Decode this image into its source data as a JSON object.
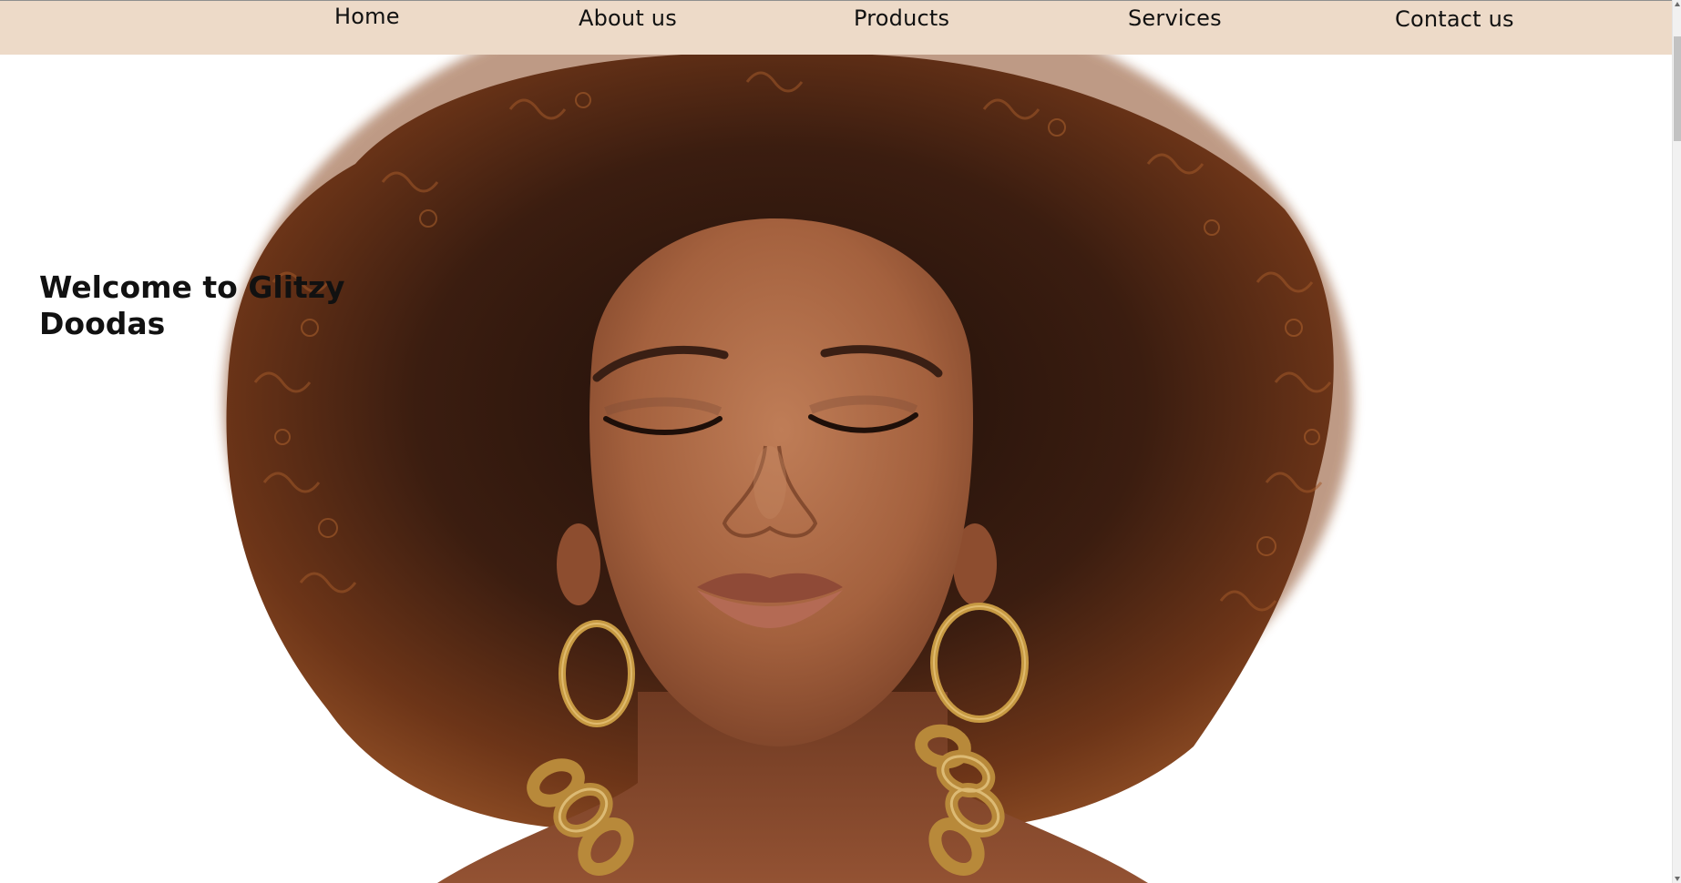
{
  "nav": {
    "items": [
      {
        "label": "Home"
      },
      {
        "label": "About us"
      },
      {
        "label": "Products"
      },
      {
        "label": "Services"
      },
      {
        "label": "Contact us"
      }
    ]
  },
  "hero": {
    "heading": "Welcome to Glitzy Doodas",
    "image_alt": "woman-with-afro-and-gold-hoop-earrings"
  },
  "colors": {
    "nav_background": "#eddac8",
    "page_background": "#ffffff",
    "text": "#111111",
    "hair_dark": "#2a1710",
    "hair_brown": "#6f3a1b",
    "skin": "#a86a48",
    "gold": "#c79a43"
  }
}
